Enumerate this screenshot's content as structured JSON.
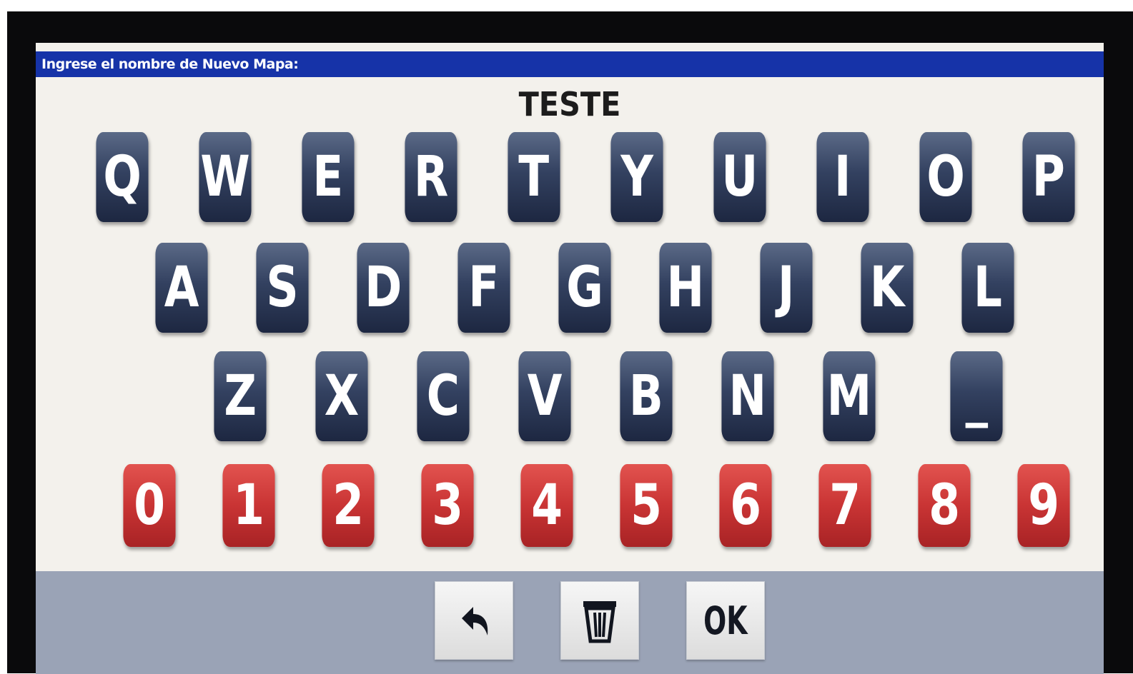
{
  "dialog": {
    "title": "Ingrese el nombre de Nuevo Mapa:",
    "input_value": "TESTE"
  },
  "keyboard": {
    "row1": [
      "Q",
      "W",
      "E",
      "R",
      "T",
      "Y",
      "U",
      "I",
      "O",
      "P"
    ],
    "row2": [
      "A",
      "S",
      "D",
      "F",
      "G",
      "H",
      "J",
      "K",
      "L"
    ],
    "row3": [
      "Z",
      "X",
      "C",
      "V",
      "B",
      "N",
      "M",
      "_"
    ],
    "digits": [
      "0",
      "1",
      "2",
      "3",
      "4",
      "5",
      "6",
      "7",
      "8",
      "9"
    ]
  },
  "actions": {
    "back_icon": "undo-arrow-icon",
    "delete_icon": "trash-icon",
    "ok_label": "OK"
  },
  "colors": {
    "letter_key": "#334160",
    "digit_key": "#c93434",
    "title_bar": "#1633a8",
    "bottom_bar": "#9aa3b6"
  }
}
